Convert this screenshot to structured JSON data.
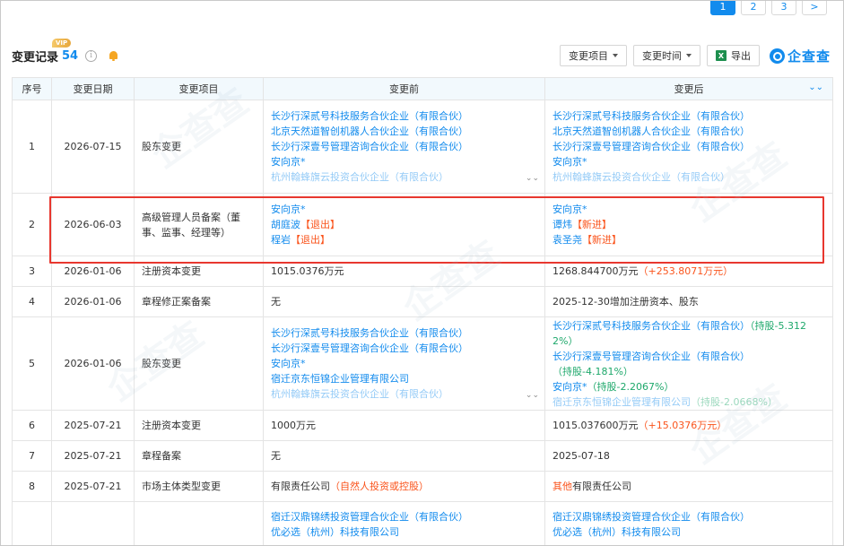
{
  "pagination": [
    "1",
    "2",
    "3",
    ">"
  ],
  "pagination_active": 0,
  "header": {
    "title": "变更记录",
    "count": "54",
    "vip": "VIP",
    "info_glyph": "i",
    "filter_item_label": "变更项目",
    "filter_time_label": "变更时间",
    "export_label": "导出",
    "excel_glyph": "X",
    "brand_text": "企查查"
  },
  "columns": [
    "序号",
    "变更日期",
    "变更项目",
    "变更前",
    "变更后"
  ],
  "collapse_glyph": "⌄⌄",
  "rows": [
    {
      "no": "1",
      "date": "2026-07-15",
      "item": "股东变更",
      "before": [
        [
          {
            "t": "长沙行深贰号科技服务合伙企业（有限合伙）",
            "c": "link"
          }
        ],
        [
          {
            "t": "北京天然道智创机器人合伙企业（有限合伙）",
            "c": "link"
          }
        ],
        [
          {
            "t": "长沙行深壹号管理咨询合伙企业（有限合伙）",
            "c": "link"
          }
        ],
        [
          {
            "t": "安向京*",
            "c": "link"
          }
        ],
        [
          {
            "t": "杭州翰蜂旗云投资合伙企业（有限合伙）",
            "c": "link fade"
          }
        ]
      ],
      "after": [
        [
          {
            "t": "长沙行深贰号科技服务合伙企业（有限合伙）",
            "c": "link"
          }
        ],
        [
          {
            "t": "北京天然道智创机器人合伙企业（有限合伙）",
            "c": "link"
          }
        ],
        [
          {
            "t": "长沙行深壹号管理咨询合伙企业（有限合伙）",
            "c": "link"
          }
        ],
        [
          {
            "t": "安向京*",
            "c": "link"
          }
        ],
        [
          {
            "t": "杭州翰蜂旗云投资合伙企业（有限合伙）",
            "c": "link fade"
          }
        ]
      ],
      "more": true
    },
    {
      "no": "2",
      "date": "2026-06-03",
      "item": "高级管理人员备案（董事、监事、经理等）",
      "before": [
        [
          {
            "t": "安向京*",
            "c": "link"
          }
        ],
        [
          {
            "t": "胡庭波",
            "c": "link"
          },
          {
            "t": "【退出】",
            "c": "red"
          }
        ],
        [
          {
            "t": "程岩",
            "c": "link"
          },
          {
            "t": "【退出】",
            "c": "red"
          }
        ]
      ],
      "after": [
        [
          {
            "t": "安向京*",
            "c": "link"
          }
        ],
        [
          {
            "t": "谭炜",
            "c": "link"
          },
          {
            "t": "【新进】",
            "c": "red"
          }
        ],
        [
          {
            "t": "袁圣尧",
            "c": "link"
          },
          {
            "t": "【新进】",
            "c": "red"
          }
        ]
      ],
      "more": false
    },
    {
      "no": "3",
      "date": "2026-01-06",
      "item": "注册资本变更",
      "before": [
        [
          {
            "t": "1015.0376万元",
            "c": ""
          }
        ]
      ],
      "after": [
        [
          {
            "t": "1268.844700万元",
            "c": ""
          },
          {
            "t": "（+253.8071万元）",
            "c": "red"
          }
        ]
      ],
      "more": false
    },
    {
      "no": "4",
      "date": "2026-01-06",
      "item": "章程修正案备案",
      "before": [
        [
          {
            "t": "无",
            "c": ""
          }
        ]
      ],
      "after": [
        [
          {
            "t": "2025-12-30增加注册资本、股东",
            "c": ""
          }
        ]
      ],
      "more": false
    },
    {
      "no": "5",
      "date": "2026-01-06",
      "item": "股东变更",
      "before": [
        [
          {
            "t": "长沙行深贰号科技服务合伙企业（有限合伙）",
            "c": "link"
          }
        ],
        [
          {
            "t": "长沙行深壹号管理咨询合伙企业（有限合伙）",
            "c": "link"
          }
        ],
        [
          {
            "t": "安向京*",
            "c": "link"
          }
        ],
        [
          {
            "t": "宿迁京东恒锦企业管理有限公司",
            "c": "link"
          }
        ],
        [
          {
            "t": "杭州翰蜂旗云投资合伙企业（有限合伙）",
            "c": "link fade"
          }
        ]
      ],
      "after": [
        [
          {
            "t": "长沙行深贰号科技服务合伙企业（有限合伙）",
            "c": "link"
          },
          {
            "t": "（持股-5.312",
            "c": "green"
          }
        ],
        [
          {
            "t": "2%）",
            "c": "green"
          }
        ],
        [
          {
            "t": "长沙行深壹号管理咨询合伙企业（有限合伙）",
            "c": "link"
          },
          {
            "t": "（持股-4.181%）",
            "c": "green"
          }
        ],
        [
          {
            "t": "安向京*",
            "c": "link"
          },
          {
            "t": "（持股-2.2067%）",
            "c": "green"
          }
        ],
        [
          {
            "t": "宿迁京东恒锦企业管理有限公司",
            "c": "link fade"
          },
          {
            "t": "（持股-2.0668%）",
            "c": "green fade"
          }
        ]
      ],
      "more": true
    },
    {
      "no": "6",
      "date": "2025-07-21",
      "item": "注册资本变更",
      "before": [
        [
          {
            "t": "1000万元",
            "c": ""
          }
        ]
      ],
      "after": [
        [
          {
            "t": "1015.037600万元",
            "c": ""
          },
          {
            "t": "（+15.0376万元）",
            "c": "red"
          }
        ]
      ],
      "more": false
    },
    {
      "no": "7",
      "date": "2025-07-21",
      "item": "章程备案",
      "before": [
        [
          {
            "t": "无",
            "c": ""
          }
        ]
      ],
      "after": [
        [
          {
            "t": "2025-07-18",
            "c": ""
          }
        ]
      ],
      "more": false
    },
    {
      "no": "8",
      "date": "2025-07-21",
      "item": "市场主体类型变更",
      "before": [
        [
          {
            "t": "有限责任公司",
            "c": ""
          },
          {
            "t": "（自然人投资或控股）",
            "c": "red"
          }
        ]
      ],
      "after": [
        [
          {
            "t": "其他",
            "c": "red"
          },
          {
            "t": "有限责任公司",
            "c": ""
          }
        ]
      ],
      "more": false
    },
    {
      "no": "",
      "date": "",
      "item": "",
      "before": [
        [
          {
            "t": "宿迁汉鼎锦绣投资管理合伙企业（有限合伙）",
            "c": "link"
          }
        ],
        [
          {
            "t": "优必选（杭州）科技有限公司",
            "c": "link"
          }
        ]
      ],
      "after": [
        [
          {
            "t": "宿迁汉鼎锦绣投资管理合伙企业（有限合伙）",
            "c": "link"
          }
        ],
        [
          {
            "t": "优必选（杭州）科技有限公司",
            "c": "link"
          }
        ]
      ],
      "more": false
    }
  ],
  "more_glyph": "⌄⌄",
  "colors": {
    "accent": "#128bed",
    "red": "#fa541c",
    "green": "#1ea86b",
    "highlight": "#e8372f"
  }
}
